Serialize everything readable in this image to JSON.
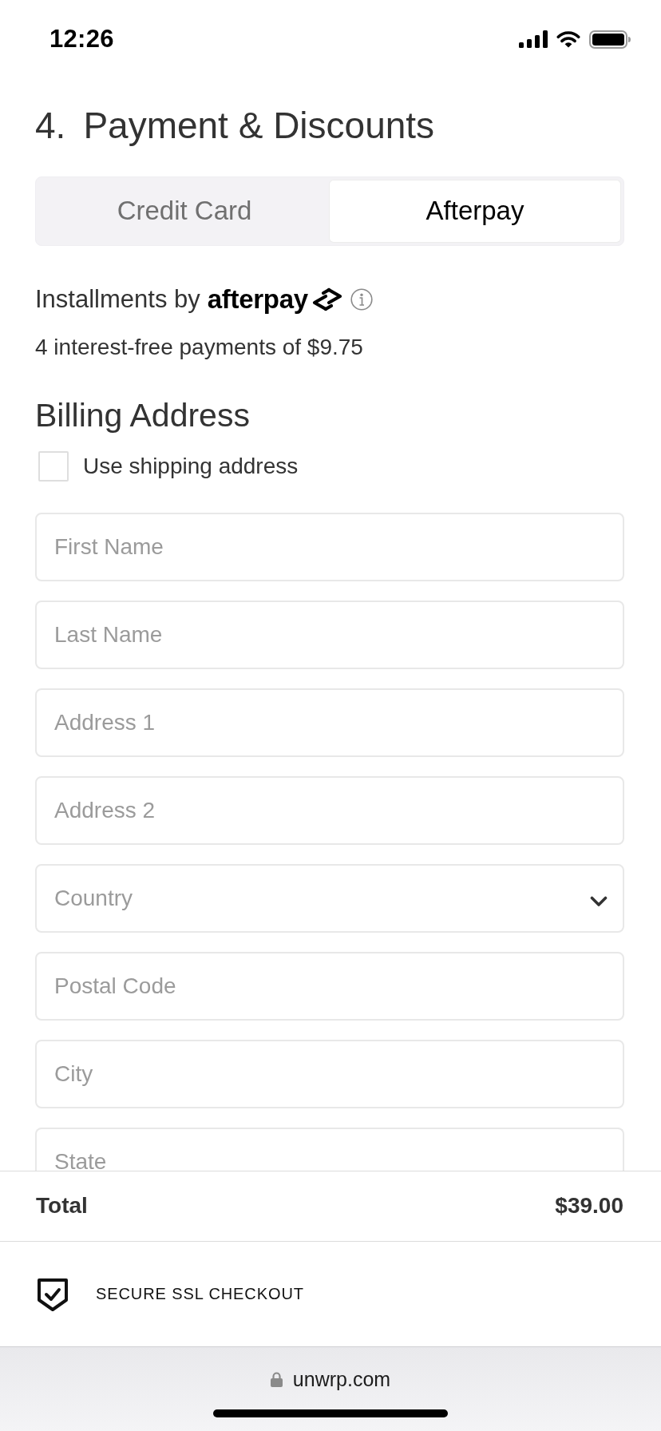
{
  "status_bar": {
    "time": "12:26"
  },
  "header": {
    "step_number": "4.",
    "title": "Payment & Discounts"
  },
  "payment_tabs": [
    {
      "label": "Credit Card",
      "selected": false
    },
    {
      "label": "Afterpay",
      "selected": true
    }
  ],
  "afterpay": {
    "label": "Installments by",
    "brand": "afterpay",
    "summary": "4 interest-free payments of $9.75"
  },
  "billing_address": {
    "heading": "Billing Address",
    "use_shipping_address": {
      "label": "Use shipping address",
      "checked": false
    },
    "fields": [
      {
        "placeholder": "First Name",
        "kind": "text"
      },
      {
        "placeholder": "Last Name",
        "kind": "text"
      },
      {
        "placeholder": "Address 1",
        "kind": "text"
      },
      {
        "placeholder": "Address 2",
        "kind": "text"
      },
      {
        "placeholder": "Country",
        "kind": "select"
      },
      {
        "placeholder": "Postal Code",
        "kind": "text"
      },
      {
        "placeholder": "City",
        "kind": "text"
      },
      {
        "placeholder": "State",
        "kind": "text"
      }
    ]
  },
  "order_total": {
    "label": "Total",
    "amount": "$39.00"
  },
  "security_note": "SECURE SSL CHECKOUT",
  "browser_bar": {
    "url": "unwrp.com"
  }
}
